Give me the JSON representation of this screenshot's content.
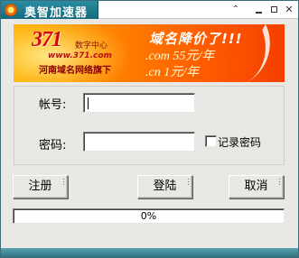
{
  "window": {
    "title": "奥智加速器",
    "title_controls": [
      "caret-up-icon",
      "minimize-icon",
      "maximize-icon",
      "close-icon"
    ]
  },
  "banner": {
    "logo_number": "371",
    "logo_sub": "数字中心",
    "logo_url": "www.371.com",
    "logo_tag": "河南域名网络旗下",
    "slogan": "域名降价了!!!",
    "price_com": ".com 55元/年",
    "price_cn": ".cn 1元/年"
  },
  "form": {
    "username_label": "帐号:",
    "username_value": "",
    "password_label": "密码:",
    "password_value": "",
    "remember_label": "记录密码",
    "remember_checked": false
  },
  "buttons": {
    "register": "注册",
    "login": "登陆",
    "cancel": "取消"
  },
  "progress": {
    "value": 0,
    "text": "0%"
  },
  "colors": {
    "title_tab": "#1e7b8e",
    "banner_orange": "#ff7e00",
    "window_bg": "#eae8e4"
  }
}
